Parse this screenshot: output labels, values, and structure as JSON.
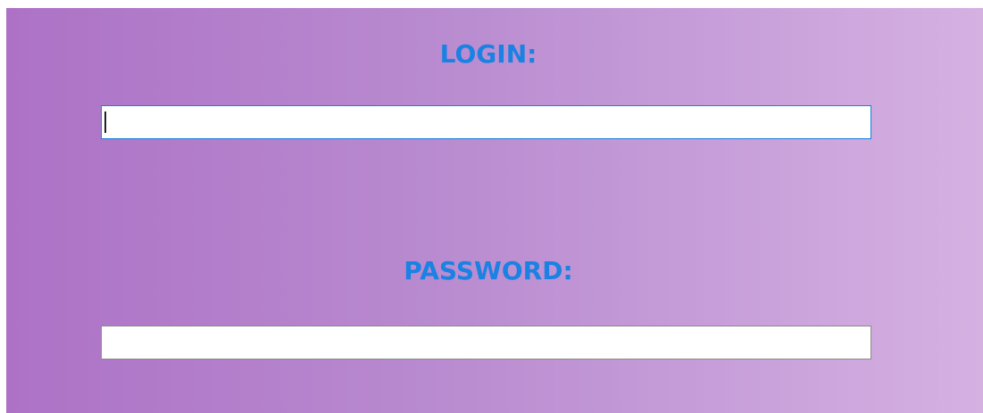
{
  "form": {
    "login_label": "LOGIN:",
    "login_value": "",
    "password_label": "PASSWORD:",
    "password_value": ""
  },
  "colors": {
    "label_color": "#1a82e2",
    "gradient_start": "#ad72c6",
    "gradient_end": "#d5b1e2",
    "focused_border": "#1a7fd9"
  }
}
